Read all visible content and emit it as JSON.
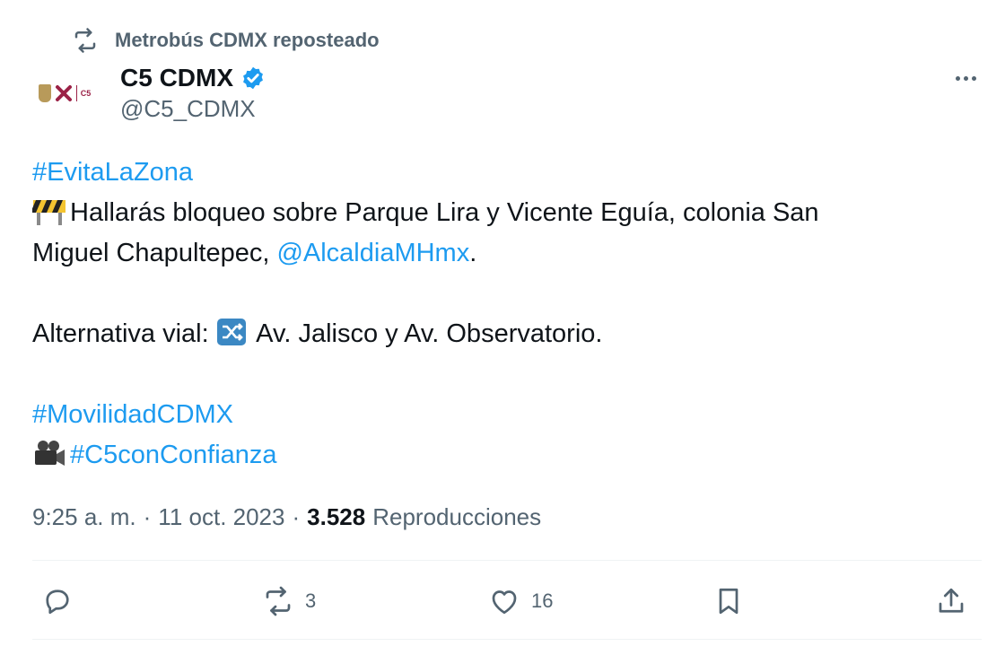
{
  "repost": {
    "label": "Metrobús CDMX reposteado",
    "icon": "repost-icon"
  },
  "author": {
    "name": "C5 CDMX",
    "handle": "@C5_CDMX",
    "verified": true,
    "avatar_label": "C5"
  },
  "tweet": {
    "hashtag1": "#EvitaLaZona",
    "line1_text": "Hallarás bloqueo sobre Parque Lira y Vicente Eguía, colonia San",
    "line2_text": "Miguel Chapultepec, ",
    "mention": "@AlcaldiaMHmx",
    "line2_end": ".",
    "line3_text": " Alternativa vial: ",
    "line3_end": " Av. Jalisco y Av. Observatorio.",
    "hashtag2": "#MovilidadCDMX",
    "hashtag3": "#C5conConfianza"
  },
  "meta": {
    "time": "9:25 a. m.",
    "separator": "·",
    "date": "11 oct. 2023",
    "views_count": "3.528",
    "views_label": "Reproducciones"
  },
  "actions": {
    "reply_count": "",
    "repost_count": "3",
    "like_count": "16"
  },
  "colors": {
    "link": "#1d9bf0",
    "muted": "#536471",
    "text": "#0f1419",
    "verified": "#1d9bf0"
  }
}
